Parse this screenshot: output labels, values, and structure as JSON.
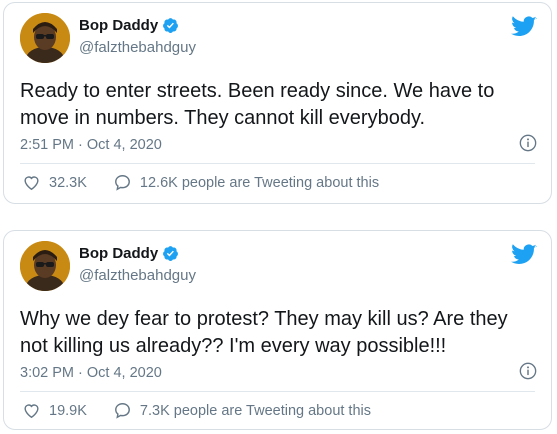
{
  "colors": {
    "accent": "#1da1f2",
    "muted": "#657786",
    "text": "#14171a",
    "border": "#d7dee4"
  },
  "tweets": [
    {
      "author": {
        "name": "Bop Daddy",
        "handle": "@falzthebahdguy",
        "verified": true
      },
      "text": "Ready to enter streets. Been ready since. We have to move in numbers. They cannot kill everybody.",
      "timestamp": "2:51 PM · Oct 4, 2020",
      "likes": "32.3K",
      "conversation": "12.6K people are Tweeting about this"
    },
    {
      "author": {
        "name": "Bop Daddy",
        "handle": "@falzthebahdguy",
        "verified": true
      },
      "text": "Why we dey fear to protest? They may kill us? Are they not killing us already?? I'm every way possible!!!",
      "timestamp": "3:02 PM · Oct 4, 2020",
      "likes": "19.9K",
      "conversation": "7.3K people are Tweeting about this"
    }
  ],
  "icons": [
    "verified-badge-icon",
    "twitter-bird-icon",
    "info-icon",
    "heart-icon",
    "speech-bubble-icon"
  ]
}
